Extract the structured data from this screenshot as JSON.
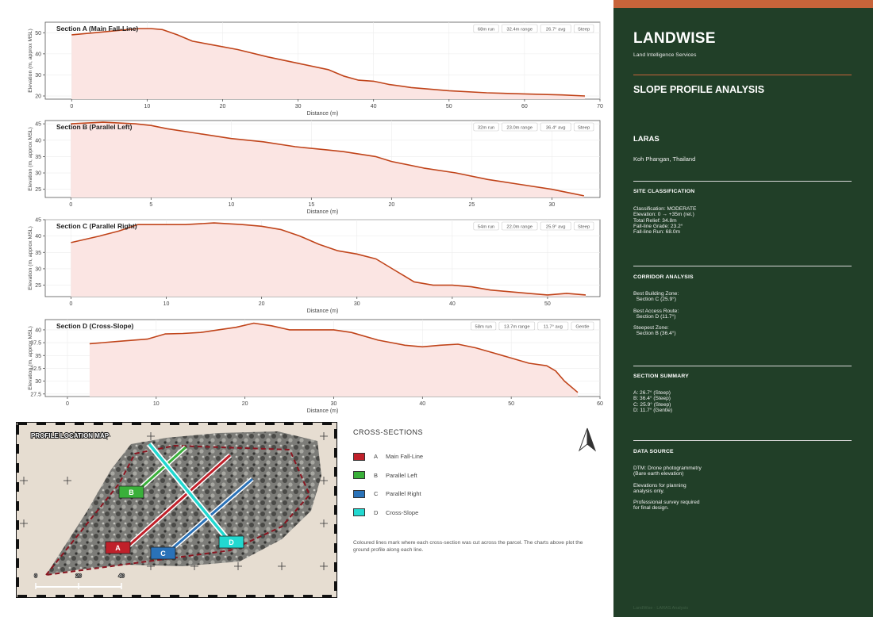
{
  "chart_data": [
    {
      "type": "area",
      "title": "Section A (Main Fall-Line)",
      "badges": [
        "68m run",
        "32.4m range",
        "26.7° avg",
        "Steep"
      ],
      "xlabel": "Distance (m)",
      "ylabel": "Elevation (m, approx MSL)",
      "xlim": [
        -3.5,
        70
      ],
      "ylim": [
        18.5,
        55
      ],
      "xticks": [
        0,
        10,
        20,
        30,
        40,
        50,
        60,
        70
      ],
      "yticks": [
        20,
        30,
        40,
        50
      ],
      "x": [
        0,
        3,
        6,
        9,
        10.5,
        12,
        14,
        16,
        19,
        22,
        26,
        30,
        34,
        36,
        38,
        40,
        42,
        45,
        50,
        55,
        60,
        65,
        68
      ],
      "y": [
        49,
        50,
        51,
        52,
        52,
        51.5,
        49,
        46,
        44,
        42,
        38.5,
        35.5,
        32.5,
        29.5,
        27.5,
        27,
        25.5,
        24,
        22.5,
        21.5,
        21,
        20.5,
        20
      ]
    },
    {
      "type": "area",
      "title": "Section B (Parallel Left)",
      "badges": [
        "32m run",
        "23.0m range",
        "36.4° avg",
        "Steep"
      ],
      "xlabel": "Distance (m)",
      "ylabel": "Elevation (m, approx MSL)",
      "xlim": [
        -1.6,
        33
      ],
      "ylim": [
        22.5,
        46
      ],
      "xticks": [
        0,
        5,
        10,
        15,
        20,
        25,
        30
      ],
      "yticks": [
        25,
        30,
        35,
        40,
        45
      ],
      "x": [
        0,
        2,
        4,
        5,
        6,
        8,
        10,
        12,
        14,
        16,
        17,
        19,
        20,
        22,
        24,
        26,
        28,
        30,
        31,
        32
      ],
      "y": [
        45,
        45.5,
        45,
        44.5,
        43.5,
        42,
        40.5,
        39.5,
        38,
        37,
        36.5,
        35,
        33.5,
        31.5,
        30,
        28,
        26.5,
        25,
        24,
        23
      ]
    },
    {
      "type": "area",
      "title": "Section C (Parallel Right)",
      "badges": [
        "54m run",
        "22.0m range",
        "25.9° avg",
        "Steep"
      ],
      "xlabel": "Distance (m)",
      "ylabel": "Elevation (m, approx MSL)",
      "xlim": [
        -2.7,
        55.5
      ],
      "ylim": [
        21.5,
        45
      ],
      "xticks": [
        0,
        10,
        20,
        30,
        40,
        50
      ],
      "yticks": [
        25,
        30,
        35,
        40,
        45
      ],
      "x": [
        0,
        3,
        5,
        7,
        9,
        12,
        15,
        18,
        20,
        22,
        24,
        26,
        28,
        30,
        32,
        34,
        36,
        38,
        40,
        42,
        44,
        46,
        48,
        50,
        52,
        54
      ],
      "y": [
        38,
        40,
        41.5,
        43.5,
        43.5,
        43.5,
        44,
        43.5,
        43,
        42,
        40,
        37.5,
        35.5,
        34.5,
        33,
        29.5,
        26,
        25,
        25,
        24.5,
        23.5,
        23,
        22.5,
        22,
        22.5,
        22
      ]
    },
    {
      "type": "area",
      "title": "Section D (Cross-Slope)",
      "badges": [
        "58m run",
        "13.7m range",
        "11.7° avg",
        "Gentle"
      ],
      "xlabel": "Distance (m)",
      "ylabel": "Elevation (m, approx MSL)",
      "xlim": [
        -2.5,
        60
      ],
      "ylim": [
        27,
        42
      ],
      "xticks": [
        0,
        10,
        20,
        30,
        40,
        50,
        60
      ],
      "yticks": [
        27.5,
        30,
        32.5,
        35,
        37.5,
        40
      ],
      "x": [
        2.5,
        6,
        9,
        11,
        13,
        15,
        17,
        19,
        21,
        23,
        25,
        27,
        30,
        32,
        35,
        38,
        40,
        42,
        44,
        46,
        48,
        50,
        52,
        54,
        55,
        56,
        57.5
      ],
      "y": [
        37.3,
        37.8,
        38.2,
        39.2,
        39.3,
        39.5,
        40,
        40.5,
        41.3,
        40.8,
        40,
        40,
        40,
        39.5,
        38,
        37,
        36.7,
        37,
        37.2,
        36.5,
        35.5,
        34.5,
        33.5,
        33,
        32,
        30,
        27.8
      ]
    }
  ],
  "map": {
    "title": "PROFILE LOCATION MAP",
    "scale_labels": [
      "0",
      "20",
      "40"
    ],
    "section_labels": [
      "A",
      "B",
      "C",
      "D"
    ]
  },
  "legend": {
    "title": "CROSS-SECTIONS",
    "items": [
      {
        "letter": "A",
        "label": "Main Fall-Line",
        "color": "#c0202a"
      },
      {
        "letter": "B",
        "label": "Parallel Left",
        "color": "#3ab03a"
      },
      {
        "letter": "C",
        "label": "Parallel Right",
        "color": "#2a72b8"
      },
      {
        "letter": "D",
        "label": "Cross-Slope",
        "color": "#22d8d0"
      }
    ],
    "note": "Coloured lines mark where each cross-section was cut across the parcel. The charts above plot the ground profile along each line."
  },
  "colors": {
    "line": "#c0441a",
    "fill": "#fbe5e3",
    "panel": "#213f28",
    "accent": "#c8643a"
  },
  "panel": {
    "brand": "LANDWISE",
    "brand_sub": "Land Intelligence Services",
    "title": "SLOPE PROFILE ANALYSIS",
    "site": "LARAS",
    "location": "Koh Phangan, Thailand",
    "site_classification": {
      "heading": "SITE CLASSIFICATION",
      "lines": [
        "Classification:  MODERATE",
        "Elevation:  0 → +35m (rel.)",
        "Total Relief:  34.8m",
        "Fall-line Grade:  23.2°",
        "Fall-line Run:  68.0m"
      ]
    },
    "corridor": {
      "heading": "CORRIDOR ANALYSIS",
      "blocks": [
        [
          "Best Building Zone:",
          "  Section C (25.9°)"
        ],
        [
          "Best Access Route:",
          "  Section D (11.7°)"
        ],
        [
          "Steepest Zone:",
          "  Section B (36.4°)"
        ]
      ]
    },
    "summary": {
      "heading": "SECTION SUMMARY",
      "lines": [
        "A: 26.7° (Steep)",
        "B: 36.4° (Steep)",
        "C: 25.9° (Steep)",
        "D: 11.7° (Gentle)"
      ]
    },
    "data_source": {
      "heading": "DATA SOURCE",
      "blocks": [
        [
          "DTM: Drone photogrammetry",
          "(Bare earth elevation)"
        ],
        [
          "Elevations for planning",
          "analysis only."
        ],
        [
          "Professional survey required",
          "for final design."
        ]
      ]
    },
    "footer": "LandWise  ·  LARAS Analysis"
  }
}
